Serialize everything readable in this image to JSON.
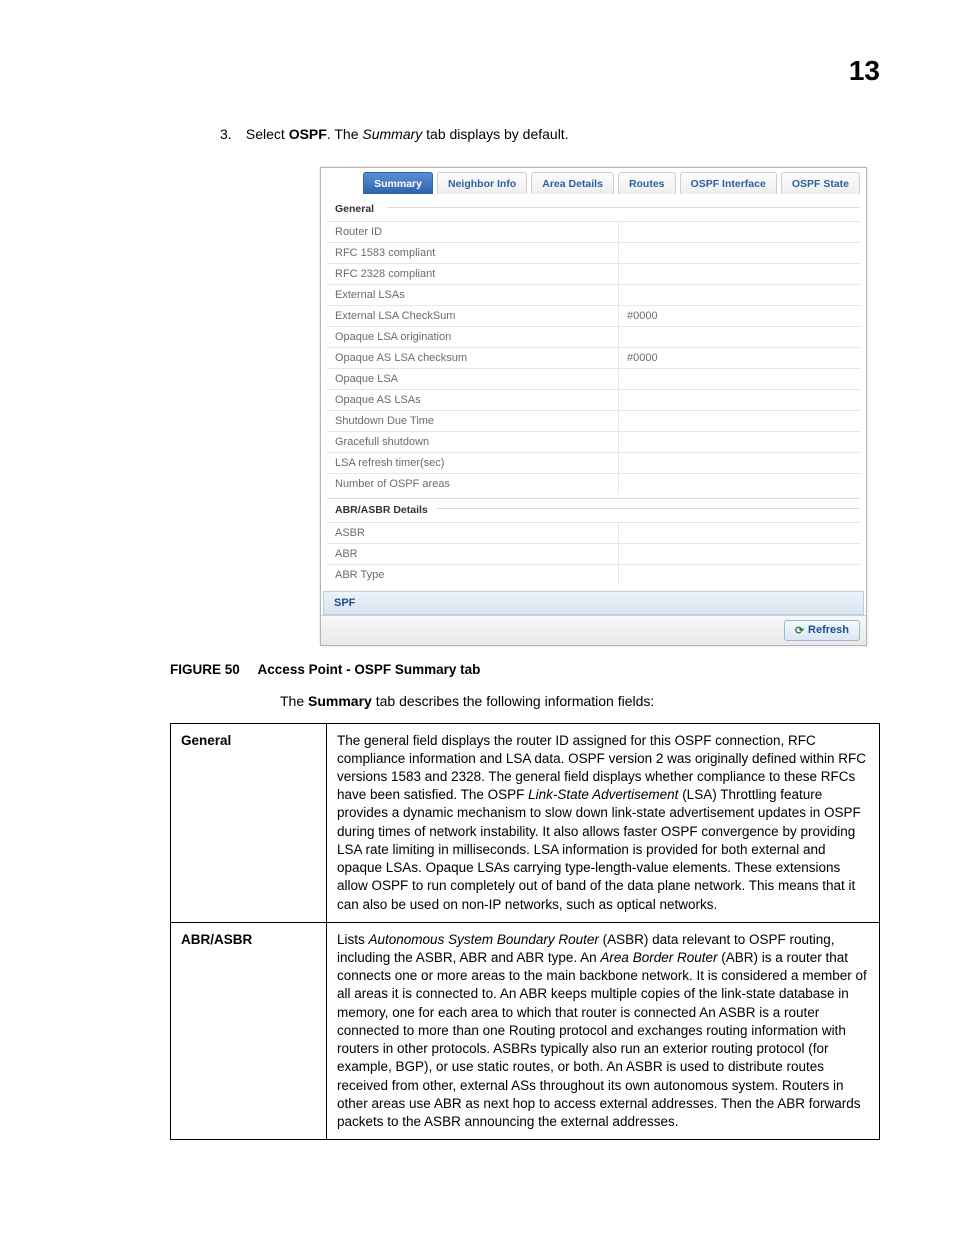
{
  "page_number": "13",
  "instruction": {
    "index": "3.",
    "lead": "Select ",
    "bold": "OSPF",
    "mid": ". The ",
    "italic": "Summary",
    "tail": " tab displays by default."
  },
  "panel": {
    "tabs": [
      "Summary",
      "Neighbor Info",
      "Area Details",
      "Routes",
      "OSPF Interface",
      "OSPF State"
    ],
    "active_tab_index": 0,
    "sections": {
      "general_title": "General",
      "general_rows": [
        {
          "label": "Router ID",
          "value": ""
        },
        {
          "label": "RFC 1583 compliant",
          "value": ""
        },
        {
          "label": "RFC 2328 compliant",
          "value": ""
        },
        {
          "label": "External LSAs",
          "value": ""
        },
        {
          "label": "External LSA CheckSum",
          "value": "#0000"
        },
        {
          "label": "Opaque LSA origination",
          "value": ""
        },
        {
          "label": "Opaque AS LSA checksum",
          "value": "#0000"
        },
        {
          "label": "Opaque LSA",
          "value": ""
        },
        {
          "label": "Opaque AS LSAs",
          "value": ""
        },
        {
          "label": "Shutdown Due Time",
          "value": ""
        },
        {
          "label": "Gracefull shutdown",
          "value": ""
        },
        {
          "label": "LSA refresh timer(sec)",
          "value": ""
        },
        {
          "label": "Number of OSPF areas",
          "value": ""
        }
      ],
      "abr_title": "ABR/ASBR Details",
      "abr_rows": [
        {
          "label": "ASBR",
          "value": ""
        },
        {
          "label": "ABR",
          "value": ""
        },
        {
          "label": "ABR Type",
          "value": ""
        }
      ],
      "spf_title": "SPF"
    },
    "refresh_label": "Refresh"
  },
  "figure": {
    "label": "FIGURE 50",
    "caption": "Access Point - OSPF Summary tab"
  },
  "summary_sentence": {
    "pre": "The ",
    "bold": "Summary",
    "post": " tab describes the following information fields:"
  },
  "def_table": [
    {
      "term": "General",
      "body_html": "The general field displays the router ID assigned for this OSPF connection, RFC compliance information and LSA data. OSPF version 2 was originally defined within RFC versions 1583 and 2328. The general field displays whether compliance to these RFCs have been satisfied. The OSPF <i>Link-State Advertisement</i> (LSA) Throttling feature provides a dynamic mechanism to slow down link-state advertisement updates in OSPF during times of network instability. It also allows faster OSPF convergence by providing LSA rate limiting in milliseconds. LSA information is provided for both external and opaque LSAs. Opaque LSAs carrying type-length-value elements. These extensions allow OSPF to run completely out of band of the data plane network. This means that it can also be used on non-IP networks, such as optical networks."
    },
    {
      "term": "ABR/ASBR",
      "body_html": "Lists <i>Autonomous System Boundary Router</i> (ASBR) data relevant to OSPF routing, including the ASBR, ABR and ABR type. An <i>Area Border Router</i> (ABR) is a router that connects one or more areas to the main backbone network. It is considered a member of all areas it is connected to. An ABR keeps multiple copies of the link-state database in memory, one for each area to which that router is connected An ASBR is a router connected to more than one Routing protocol and exchanges routing information with routers in other protocols. ASBRs typically also run an exterior routing protocol (for example, BGP), or use static routes, or both. An ASBR is used to distribute routes received from other, external ASs throughout its own autonomous system. Routers in other areas use ABR as next hop to access external addresses. Then the ABR forwards packets to the ASBR announcing the external addresses."
    }
  ]
}
